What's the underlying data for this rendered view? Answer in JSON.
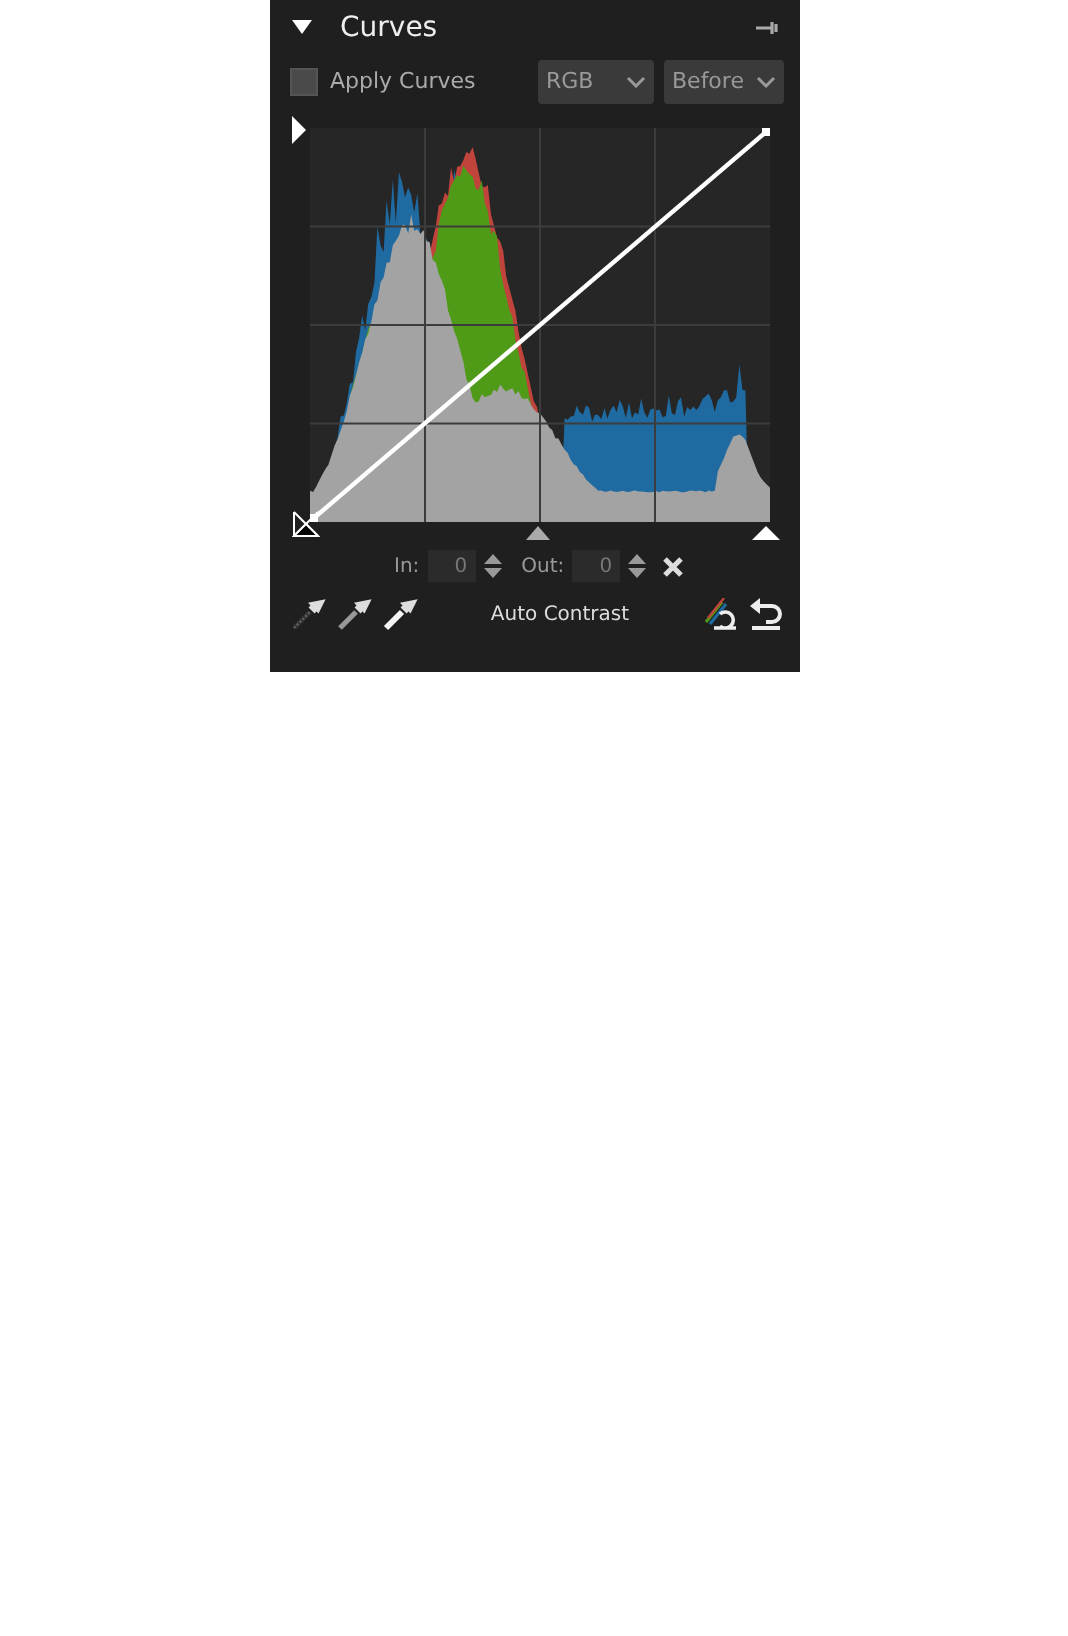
{
  "panel": {
    "title": "Curves",
    "expanded": true
  },
  "apply_curves": {
    "label": "Apply Curves",
    "checked": false
  },
  "channel_dropdown": {
    "value": "RGB"
  },
  "view_dropdown": {
    "value": "Before"
  },
  "input": {
    "label": "In:",
    "value": "0"
  },
  "output": {
    "label": "Out:",
    "value": "0"
  },
  "auto_contrast_button": {
    "label": "Auto Contrast"
  }
}
